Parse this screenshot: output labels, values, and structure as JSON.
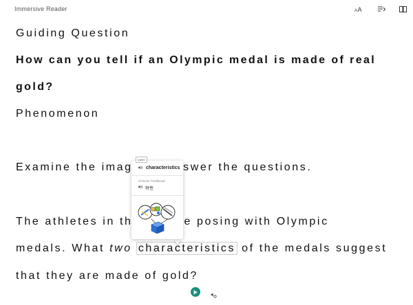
{
  "app": {
    "title": "Immersive Reader"
  },
  "toolbar": {
    "text_preferences_icon": "text-size-icon",
    "grammar_options_icon": "grammar-options-icon",
    "reading_preferences_icon": "book-icon"
  },
  "content": {
    "guiding_heading": "Guiding Question",
    "question_line1": "How can you tell if an Olympic medal is made of real",
    "question_line2": "gold?",
    "phenomenon_heading": "Phenomenon",
    "examine_before": "Examine the image",
    "examine_after": "swer the questions.",
    "athletes_before": "The athletes in the",
    "athletes_after": "are posing with Olympic",
    "medals_before": "medals. What ",
    "medals_italic": "two",
    "medals_space": " ",
    "medals_highlight": "characteristics",
    "medals_after": " of the medals suggest",
    "final_line": "that they are made of gold?"
  },
  "popup": {
    "listen_label": "Listen",
    "word": "characteristics",
    "translation_language": "Chinese Traditional",
    "translation": "特性",
    "speaker_icon": "speaker-icon",
    "picture_icon": "picture-dictionary-icon"
  },
  "bottombar": {
    "play_icon": "play-icon",
    "voice_settings_icon": "voice-settings-icon"
  },
  "colors": {
    "play_button": "#1b8f7e",
    "cube": "#2d6fd6"
  }
}
